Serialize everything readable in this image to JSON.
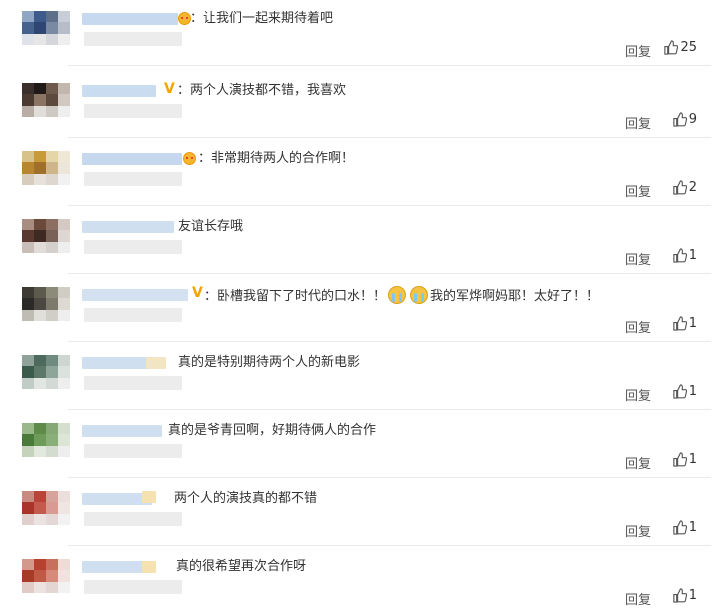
{
  "reply_label": "回复",
  "comments": [
    {
      "text": "：让我们一起来期待着吧",
      "likes": "25"
    },
    {
      "text": "：两个人演技都不错，我喜欢",
      "likes": "9"
    },
    {
      "text": "：非常期待两人的合作啊！",
      "likes": "2"
    },
    {
      "text": "友谊长存哦",
      "likes": "1"
    },
    {
      "text_a": "：卧槽我留下了时代的口水！！",
      "text_b": "我的军烨啊妈耶！太好了！！",
      "likes": "1"
    },
    {
      "text": "真的是特别期待两个人的新电影",
      "likes": "1"
    },
    {
      "text": "真的是爷青回啊，好期待俩人的合作",
      "likes": "1"
    },
    {
      "text": "两个人的演技真的都不错",
      "likes": "1"
    },
    {
      "text": "真的很希望再次合作呀",
      "likes": "1"
    }
  ],
  "colors": {
    "divider": "#e9e9e9",
    "accent": "#f5a300",
    "text": "#333333"
  }
}
